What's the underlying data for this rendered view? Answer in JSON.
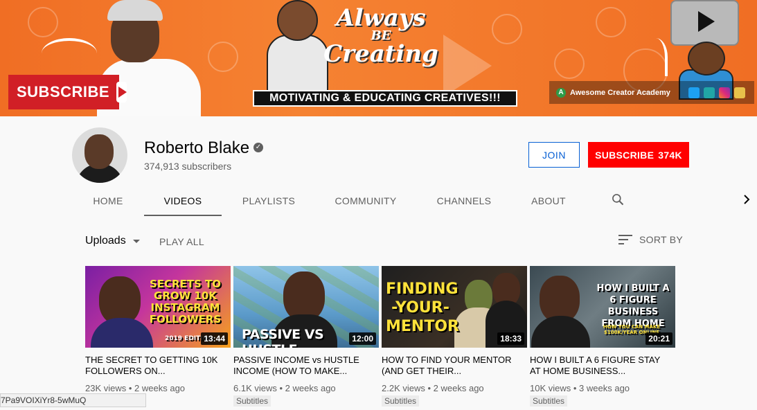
{
  "banner": {
    "subscribe_text": "SUBSCRIBE",
    "script_line1": "Always",
    "script_line2": "BE",
    "script_line3": "Creating",
    "slogan": "MOTIVATING & EDUCATING CREATIVES!!!",
    "link_label": "Awesome Creator Academy",
    "colors": {
      "orange": "#f06e24",
      "red": "#d11f26"
    }
  },
  "channel": {
    "name": "Roberto Blake",
    "subscribers": "374,913 subscribers",
    "join_label": "JOIN",
    "subscribe_label": "SUBSCRIBE",
    "subscribe_count": "374K"
  },
  "tabs": [
    {
      "label": "HOME"
    },
    {
      "label": "VIDEOS"
    },
    {
      "label": "PLAYLISTS"
    },
    {
      "label": "COMMUNITY"
    },
    {
      "label": "CHANNELS"
    },
    {
      "label": "ABOUT"
    }
  ],
  "active_tab": "VIDEOS",
  "content": {
    "uploads_label": "Uploads",
    "play_all_label": "PLAY ALL",
    "sort_label": "SORT BY"
  },
  "videos": [
    {
      "thumb_text": "SECRETS TO GROW 10K INSTAGRAM FOLLOWERS",
      "thumb_sub": "2019 EDITION",
      "duration": "13:44",
      "title": "THE SECRET TO GETTING 10K FOLLOWERS ON...",
      "views": "23K views",
      "age": "2 weeks ago",
      "badge": ""
    },
    {
      "thumb_text": "PASSIVE VS HUSTLE",
      "thumb_sub": "",
      "duration": "12:00",
      "title": "PASSIVE INCOME vs HUSTLE INCOME (HOW TO MAKE...",
      "views": "6.1K views",
      "age": "2 weeks ago",
      "badge": "Subtitles"
    },
    {
      "thumb_text": "FINDING -YOUR- MENTOR",
      "thumb_sub": "",
      "duration": "18:33",
      "title": "HOW TO FIND YOUR MENTOR (AND GET THEIR...",
      "views": "2.2K views",
      "age": "2 weeks ago",
      "badge": "Subtitles"
    },
    {
      "thumb_text": "HOW I BUILT A 6 FIGURE BUSINESS FROM HOME",
      "thumb_sub": "HOW YOU CAN MAKE $100K/YEAR ONLINE",
      "duration": "20:21",
      "title": "HOW I BUILT A 6 FIGURE STAY AT HOME BUSINESS...",
      "views": "10K views",
      "age": "3 weeks ago",
      "badge": "Subtitles"
    }
  ],
  "status_url": "7Pa9VOIXiYr8-5wMuQ"
}
